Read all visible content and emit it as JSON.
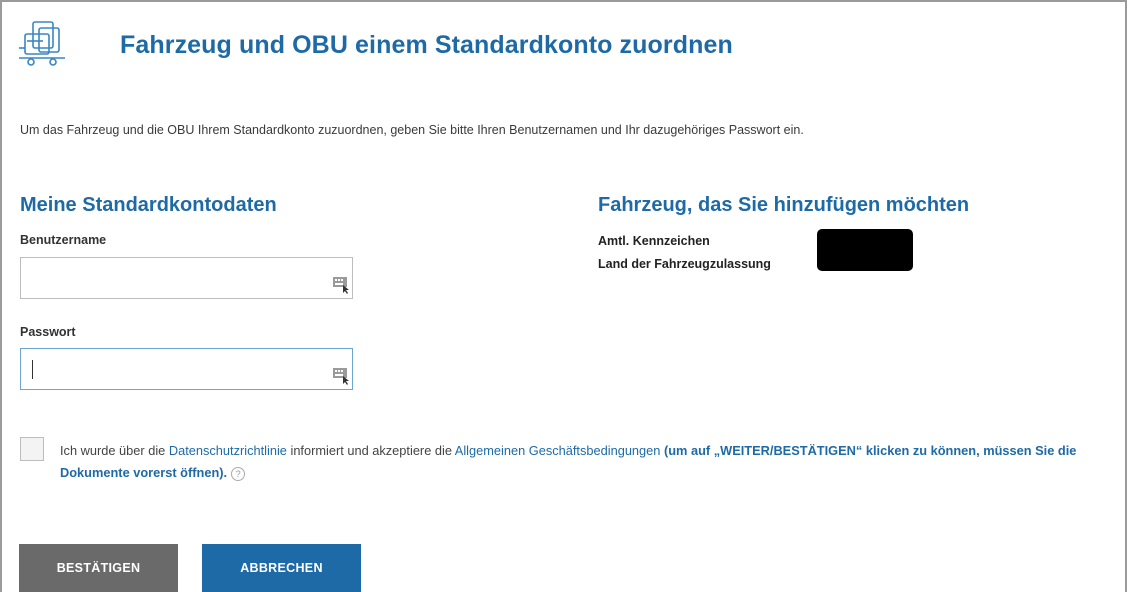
{
  "header": {
    "title": "Fahrzeug und OBU einem Standardkonto zuordnen",
    "icon": "truck-icon"
  },
  "intro_text": "Um das Fahrzeug und die OBU Ihrem Standardkonto zuzuordnen, geben Sie bitte Ihren Benutzernamen und Ihr dazugehöriges Passwort ein.",
  "account": {
    "section_title": "Meine Standardkontodaten",
    "username_label": "Benutzername",
    "username_value": "",
    "password_label": "Passwort",
    "password_value": ""
  },
  "vehicle": {
    "section_title": "Fahrzeug, das Sie hinzufügen möchten",
    "plate_label": "Amtl. Kennzeichen",
    "country_label": "Land der Fahrzeugzulassung"
  },
  "consent": {
    "text_1": "Ich wurde über die ",
    "privacy_link": "Datenschutzrichtlinie",
    "text_2": " informiert und akzeptiere die ",
    "terms_link": "Allgemeinen Geschäftsbedingungen",
    "note": " (um auf „WEITER/BESTÄTIGEN“ klicken zu können, müssen Sie die Dokumente vorerst öffnen).",
    "help_glyph": "?"
  },
  "buttons": {
    "confirm": "BESTÄTIGEN",
    "cancel": "ABBRECHEN"
  },
  "colors": {
    "accent": "#1e6aa6",
    "confirm_button": "#6a6a6a"
  }
}
